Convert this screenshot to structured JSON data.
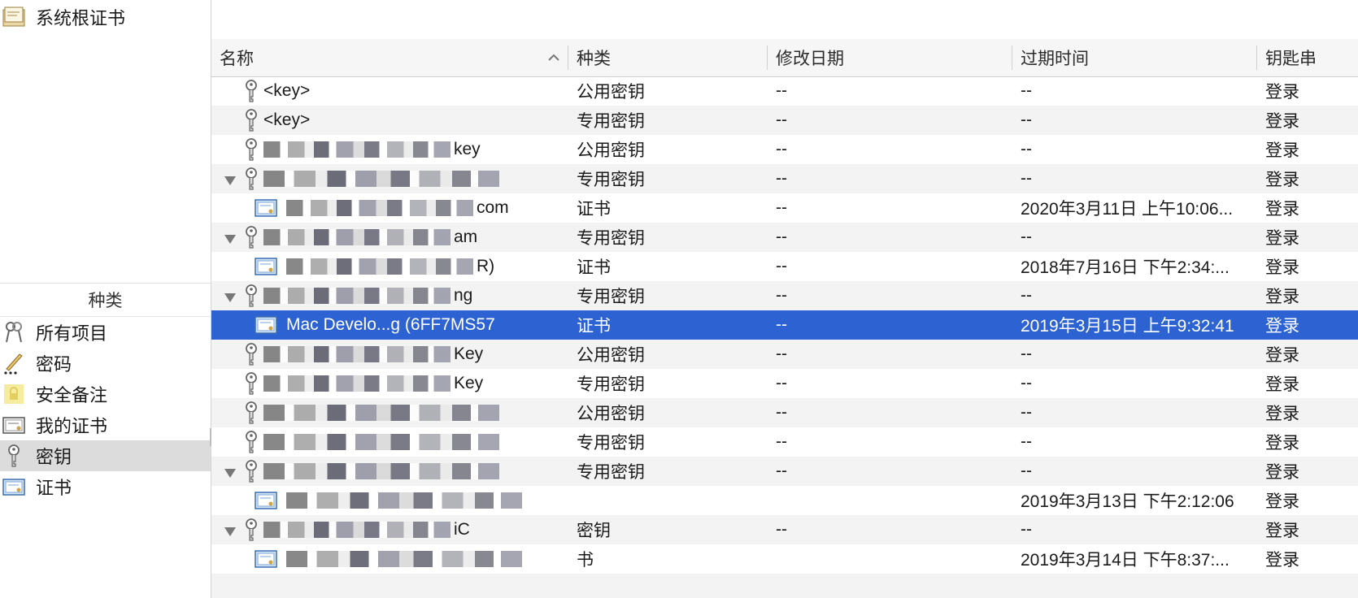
{
  "sidebar": {
    "keychains": [
      {
        "label": "系统根证书",
        "icon": "certificate-folder-icon"
      }
    ],
    "category_header": "种类",
    "categories": [
      {
        "label": "所有项目",
        "icon": "all-items-icon",
        "selected": false
      },
      {
        "label": "密码",
        "icon": "password-icon",
        "selected": false
      },
      {
        "label": "安全备注",
        "icon": "secure-note-icon",
        "selected": false
      },
      {
        "label": "我的证书",
        "icon": "my-certificate-icon",
        "selected": false
      },
      {
        "label": "密钥",
        "icon": "key-icon",
        "selected": true
      },
      {
        "label": "证书",
        "icon": "certificate-icon",
        "selected": false
      }
    ]
  },
  "table": {
    "columns": {
      "name": "名称",
      "kind": "种类",
      "modified": "修改日期",
      "expires": "过期时间",
      "keychain": "钥匙串"
    },
    "rows": [
      {
        "icon": "key",
        "disclosure": "none",
        "indent": 0,
        "name": "<key>",
        "kind": "公用密钥",
        "modified": "--",
        "expires": "--",
        "keychain": "登录"
      },
      {
        "icon": "key",
        "disclosure": "none",
        "indent": 0,
        "name": "<key>",
        "kind": "专用密钥",
        "modified": "--",
        "expires": "--",
        "keychain": "登录"
      },
      {
        "icon": "key",
        "disclosure": "none",
        "indent": 0,
        "name": "key",
        "redacted": true,
        "kind": "公用密钥",
        "modified": "--",
        "expires": "--",
        "keychain": "登录"
      },
      {
        "icon": "key",
        "disclosure": "open",
        "indent": 0,
        "name": "",
        "redacted": true,
        "kind": "专用密钥",
        "modified": "--",
        "expires": "--",
        "keychain": "登录"
      },
      {
        "icon": "cert",
        "disclosure": "none",
        "indent": 1,
        "name": "com",
        "redacted": true,
        "kind": "证书",
        "modified": "--",
        "expires": "2020年3月11日 上午10:06...",
        "keychain": "登录"
      },
      {
        "icon": "key",
        "disclosure": "open",
        "indent": 0,
        "name": "am",
        "redacted": true,
        "kind": "专用密钥",
        "modified": "--",
        "expires": "--",
        "keychain": "登录"
      },
      {
        "icon": "cert",
        "disclosure": "none",
        "indent": 1,
        "name": "R)",
        "redacted": true,
        "kind": "证书",
        "modified": "--",
        "expires": "2018年7月16日 下午2:34:...",
        "keychain": "登录"
      },
      {
        "icon": "key",
        "disclosure": "open",
        "indent": 0,
        "name": "ng",
        "redacted": true,
        "kind": "专用密钥",
        "modified": "--",
        "expires": "--",
        "keychain": "登录"
      },
      {
        "icon": "cert",
        "disclosure": "none",
        "indent": 1,
        "name": "Mac Develo...g (6FF7MS57",
        "kind": "证书",
        "modified": "--",
        "expires": "2019年3月15日 上午9:32:41",
        "keychain": "登录",
        "selected": true
      },
      {
        "icon": "key",
        "disclosure": "none",
        "indent": 0,
        "name": "Key",
        "redacted": true,
        "kind": "公用密钥",
        "modified": "--",
        "expires": "--",
        "keychain": "登录"
      },
      {
        "icon": "key",
        "disclosure": "none",
        "indent": 0,
        "name": "Key",
        "redacted": true,
        "kind": "专用密钥",
        "modified": "--",
        "expires": "--",
        "keychain": "登录"
      },
      {
        "icon": "key",
        "disclosure": "none",
        "indent": 0,
        "name": "",
        "redacted": true,
        "kind": "公用密钥",
        "modified": "--",
        "expires": "--",
        "keychain": "登录"
      },
      {
        "icon": "key",
        "disclosure": "none",
        "indent": 0,
        "name": "",
        "redacted": true,
        "kind": "专用密钥",
        "modified": "--",
        "expires": "--",
        "keychain": "登录"
      },
      {
        "icon": "key",
        "disclosure": "open",
        "indent": 0,
        "name": "",
        "redacted": true,
        "kind": "专用密钥",
        "modified": "--",
        "expires": "--",
        "keychain": "登录"
      },
      {
        "icon": "cert",
        "disclosure": "none",
        "indent": 1,
        "name": "",
        "redacted": true,
        "kind": "",
        "modified": "",
        "expires": "2019年3月13日 下午2:12:06",
        "keychain": "登录"
      },
      {
        "icon": "key",
        "disclosure": "open",
        "indent": 0,
        "name": "iC",
        "redacted": true,
        "kind": "密钥",
        "modified": "--",
        "expires": "--",
        "keychain": "登录"
      },
      {
        "icon": "cert",
        "disclosure": "none",
        "indent": 1,
        "name": "",
        "redacted": true,
        "kind": "书",
        "modified": "",
        "expires": "2019年3月14日 下午8:37:...",
        "keychain": "登录"
      }
    ]
  },
  "colors": {
    "selection": "#2c62d2",
    "sidebar_selection": "#dcdcdc",
    "alt_row": "#f3f3f3"
  }
}
